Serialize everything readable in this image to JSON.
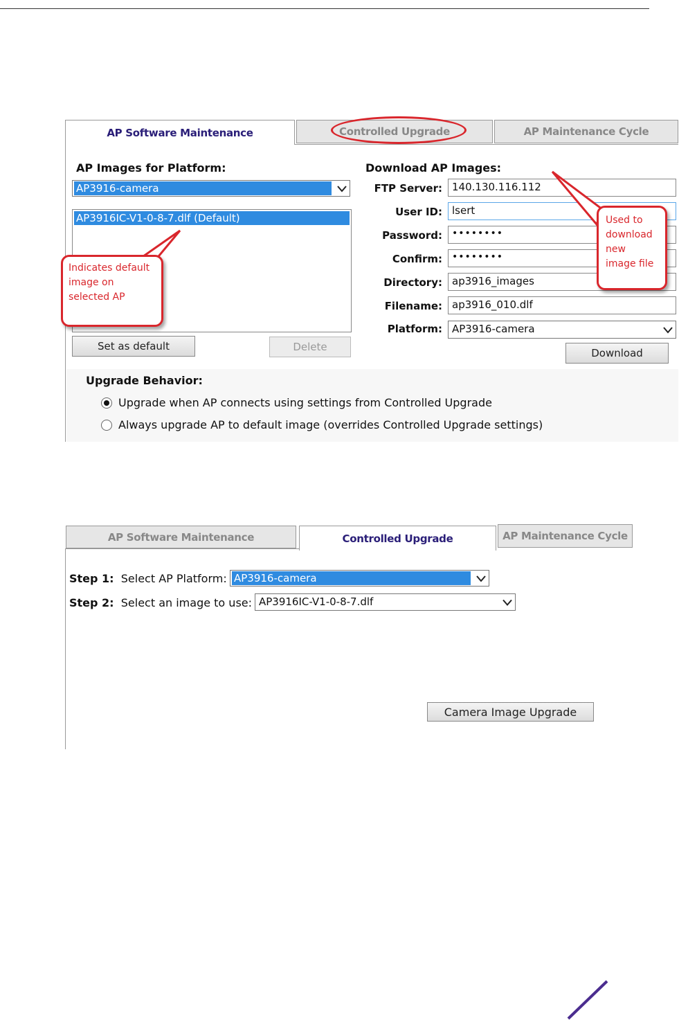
{
  "panel1": {
    "tabs": [
      "AP Software Maintenance",
      "Controlled Upgrade",
      "AP Maintenance Cycle"
    ],
    "images_heading": "AP Images for Platform:",
    "platform_select": "AP3916-camera",
    "image_list": [
      "AP3916IC-V1-0-8-7.dlf (Default)"
    ],
    "set_default_label": "Set as default",
    "delete_label": "Delete",
    "download_heading": "Download AP Images:",
    "fields": {
      "ftp_server": {
        "label": "FTP Server:",
        "value": "140.130.116.112"
      },
      "user_id": {
        "label": "User ID:",
        "value": "lsert"
      },
      "password": {
        "label": "Password:",
        "value": "••••••••"
      },
      "confirm": {
        "label": "Confirm:",
        "value": "••••••••"
      },
      "directory": {
        "label": "Directory:",
        "value": "ap3916_images"
      },
      "filename": {
        "label": "Filename:",
        "value": "ap3916_010.dlf"
      },
      "platform": {
        "label": "Platform:",
        "value": "AP3916-camera"
      }
    },
    "download_label": "Download",
    "upgrade_behavior_heading": "Upgrade Behavior:",
    "upgrade_options": [
      {
        "label": "Upgrade when AP connects using settings from Controlled Upgrade",
        "selected": true
      },
      {
        "label": "Always upgrade AP to default image (overrides Controlled Upgrade settings)",
        "selected": false
      }
    ],
    "callout_default": "Indicates default image on selected AP",
    "callout_download": "Used to download new image file"
  },
  "panel2": {
    "tabs": [
      "AP Software Maintenance",
      "Controlled Upgrade",
      "AP Maintenance Cycle"
    ],
    "step1_prefix": "Step 1:",
    "step1_text": "Select AP Platform:",
    "step1_value": "AP3916-camera",
    "step2_prefix": "Step 2:",
    "step2_text": "Select an image to use:",
    "step2_value": "AP3916IC-V1-0-8-7.dlf",
    "camera_upgrade_label": "Camera Image Upgrade"
  },
  "colors": {
    "accent": "#2f8be0",
    "annotation": "#d9262c",
    "active_tab_text": "#2a1e78"
  }
}
